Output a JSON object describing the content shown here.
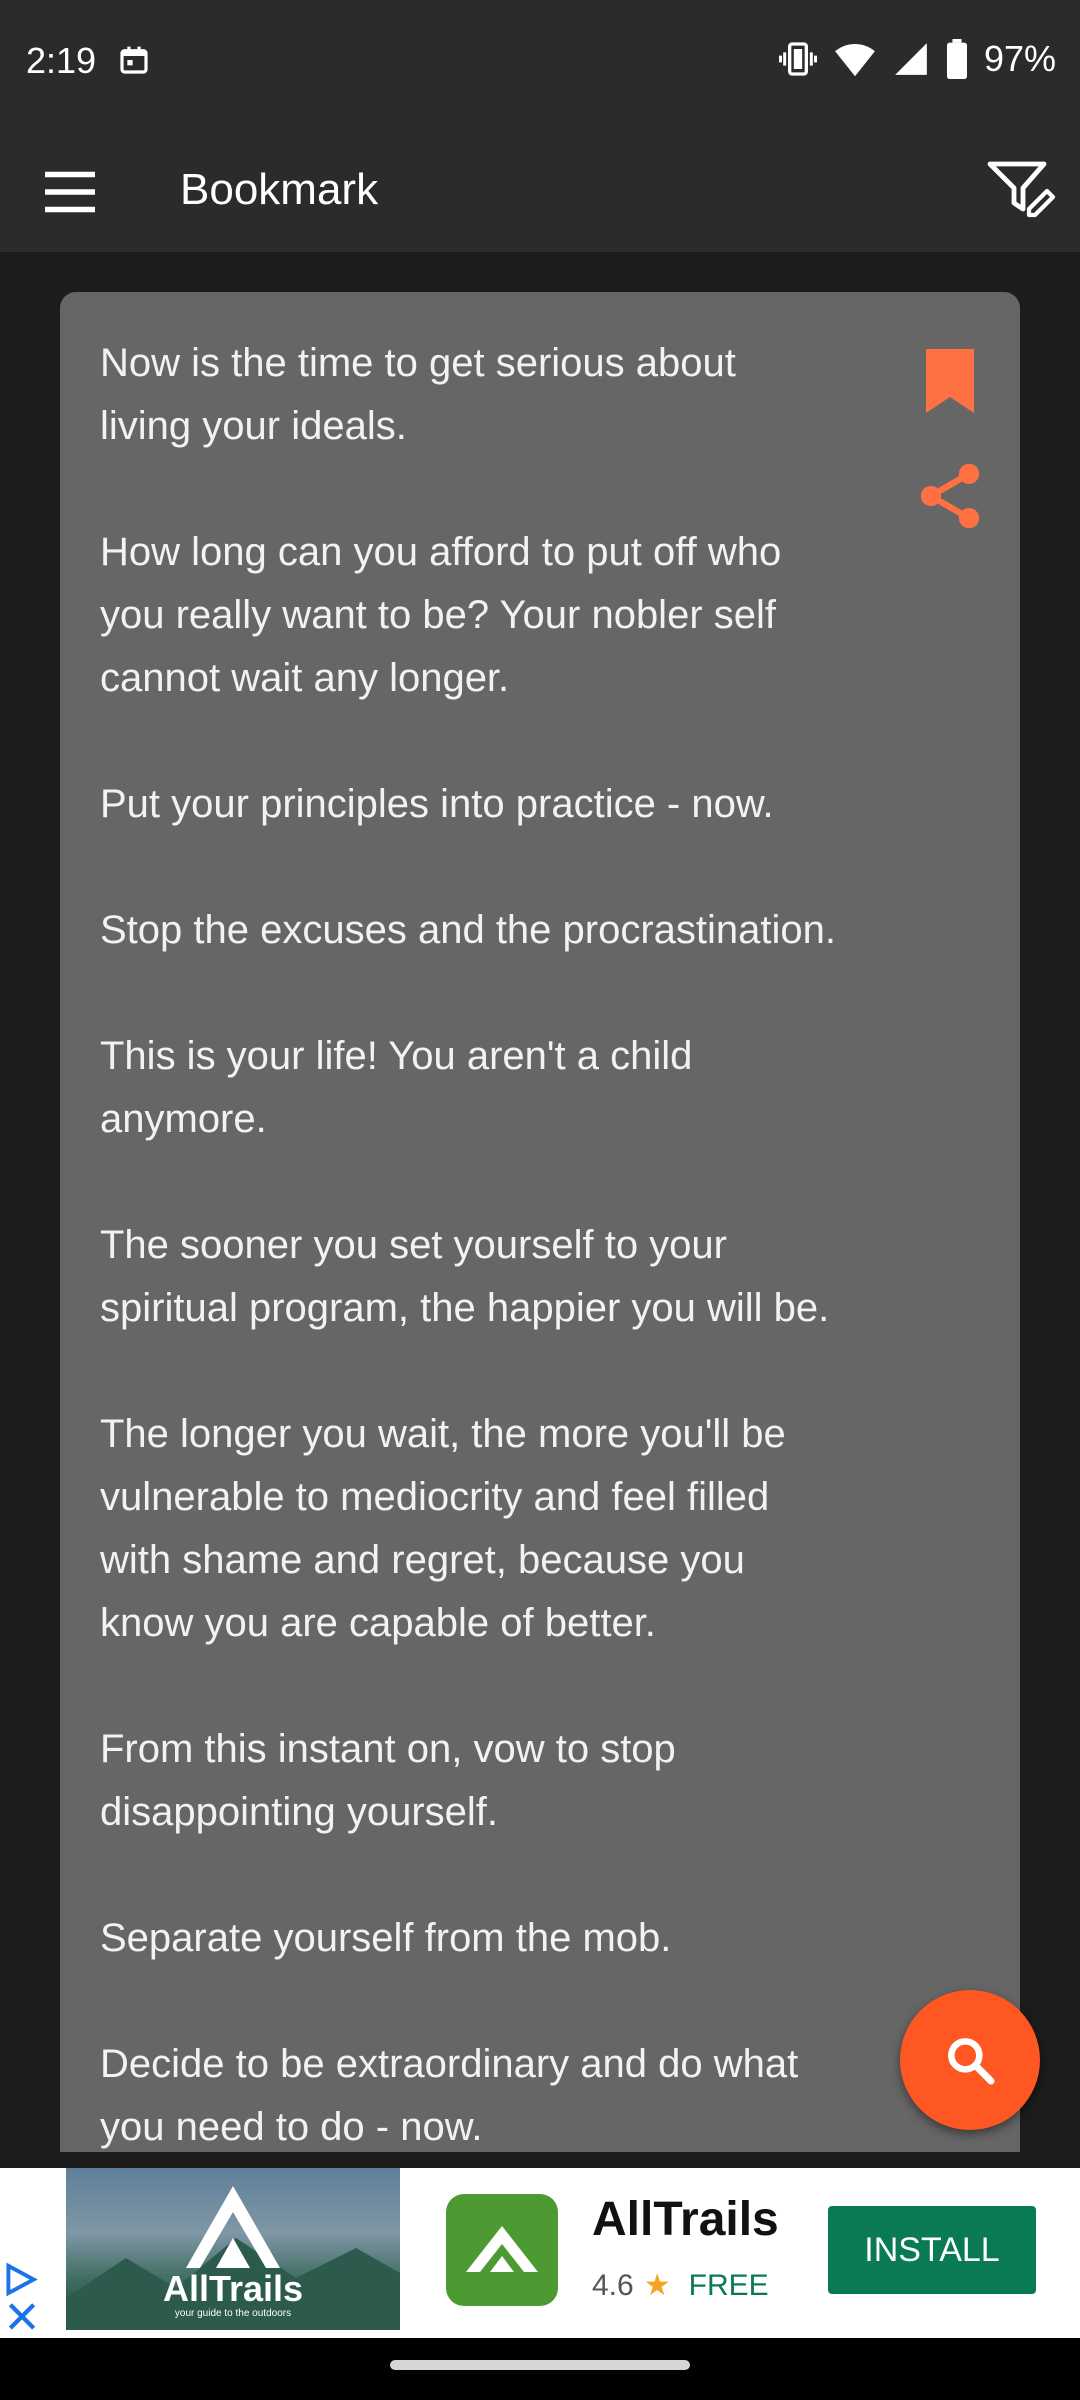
{
  "status_bar": {
    "time": "2:19",
    "battery": "97%"
  },
  "app_bar": {
    "title": "Bookmark"
  },
  "quote": {
    "text": "Now is the time to get serious about\nliving your ideals.\n\nHow long can you afford to put off who\nyou really want to be? Your nobler self\ncannot wait any longer.\n\nPut your principles into practice - now.\n\nStop the excuses and the procrastination.\n\nThis is your life! You aren't a child\nanymore.\n\nThe sooner you set yourself to your\nspiritual program, the happier you will be.\n\nThe longer you wait, the more you'll be\nvulnerable to mediocrity and feel filled\nwith shame and regret, because you\nknow you are capable of better.\n\nFrom this instant on, vow to stop\ndisappointing yourself.\n\nSeparate yourself from the mob.\n\nDecide to be extraordinary and do what\nyou need to do - now."
  },
  "ad": {
    "image_brand": "AllTrails",
    "image_tagline": "your guide to the outdoors",
    "app_name": "AllTrails",
    "rating": "4.6",
    "price": "FREE",
    "install_label": "INSTALL"
  },
  "colors": {
    "accent": "#ff5722",
    "card": "#666666",
    "background": "#1c1c1c",
    "app_bar": "#2b2b2b",
    "install": "#0a7a55"
  },
  "icons": [
    "calendar-icon",
    "vibrate-icon",
    "wifi-icon",
    "signal-icon",
    "battery-icon",
    "menu-icon",
    "filter-edit-icon",
    "bookmark-icon",
    "share-icon",
    "search-icon",
    "ad-choices-icon",
    "close-icon",
    "star-icon"
  ]
}
